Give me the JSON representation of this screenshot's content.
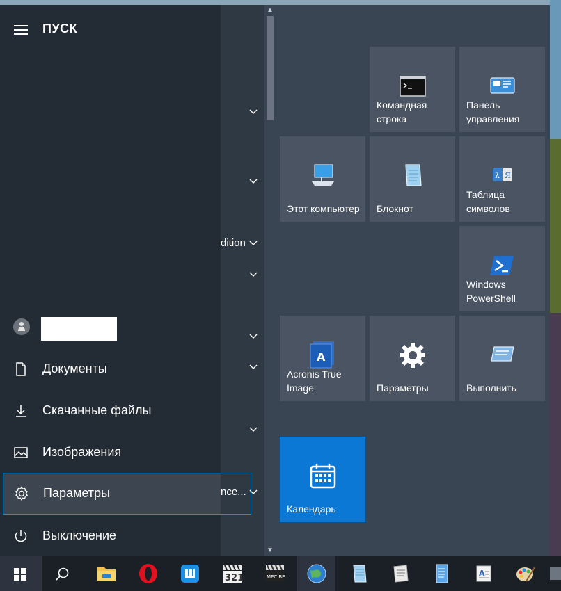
{
  "start_menu": {
    "title": "ПУСК",
    "user_name": "",
    "rail_items": [
      {
        "label": "Документы",
        "icon": "document-icon"
      },
      {
        "label": "Скачанные файлы",
        "icon": "download-icon"
      },
      {
        "label": "Изображения",
        "icon": "pictures-icon"
      },
      {
        "label": "Параметры",
        "icon": "gear-icon"
      },
      {
        "label": "Выключение",
        "icon": "power-icon"
      }
    ],
    "app_list_peek": {
      "edition_text": "dition",
      "ellipsis_text": "nce..."
    }
  },
  "tiles": [
    {
      "label": "Командная строка",
      "icon": "command-prompt-icon"
    },
    {
      "label": "Панель управления",
      "icon": "control-panel-icon"
    },
    {
      "label": "Этот компьютер",
      "icon": "computer-icon"
    },
    {
      "label": "Блокнот",
      "icon": "notepad-icon"
    },
    {
      "label": "Таблица символов",
      "icon": "character-map-icon"
    },
    {
      "label": "Windows PowerShell",
      "icon": "powershell-icon"
    },
    {
      "label": "Acronis True Image",
      "icon": "acronis-icon"
    },
    {
      "label": "Параметры",
      "icon": "gear-icon"
    },
    {
      "label": "Выполнить",
      "icon": "run-icon"
    },
    {
      "label": "Календарь",
      "icon": "calendar-icon"
    }
  ],
  "taskbar": {
    "items": [
      "windows-start-icon",
      "search-icon",
      "file-explorer-icon",
      "opera-icon",
      "maxthon-icon",
      "media-player-321-icon",
      "mpc-be-icon",
      "globe-browser-icon",
      "notepad-icon",
      "document-editor-icon",
      "notes-icon",
      "wordpad-icon",
      "paint-icon",
      "settings-icon"
    ],
    "mpc_label": "MPC BE",
    "player_label": "321"
  },
  "colors": {
    "rail_bg": "#232b35",
    "tile_bg": "#4a5462",
    "accent": "#0a78d4",
    "focus_border": "#1e8fd0"
  }
}
